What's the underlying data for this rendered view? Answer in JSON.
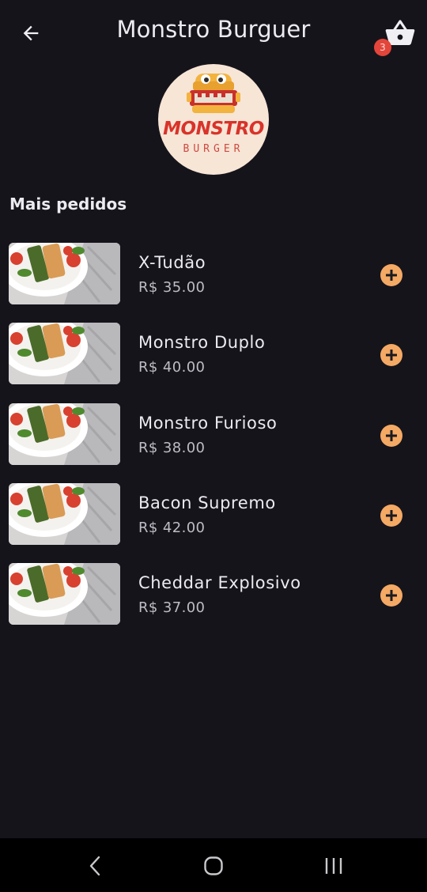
{
  "appbar": {
    "title": "Monstro Burguer",
    "back_icon": "arrow-left-icon",
    "cart_icon": "shopping-basket-icon",
    "cart_count": "3"
  },
  "logo": {
    "title": "MONSTRO",
    "subtitle": "BURGER"
  },
  "section": {
    "title": "Mais pedidos"
  },
  "products": [
    {
      "name": "X-Tudão",
      "price": "R$ 35.00"
    },
    {
      "name": "Monstro Duplo",
      "price": "R$ 40.00"
    },
    {
      "name": "Monstro Furioso",
      "price": "R$ 38.00"
    },
    {
      "name": "Bacon Supremo",
      "price": "R$ 42.00"
    },
    {
      "name": "Cheddar Explosivo",
      "price": "R$ 37.00"
    }
  ],
  "system_nav": {
    "back_icon": "chevron-left-icon",
    "home_icon": "home-circle-icon",
    "recents_icon": "recents-bars-icon"
  },
  "colors": {
    "background": "#16141b",
    "accent": "#f4a964",
    "badge": "#e3453b",
    "logo_red": "#d9332a"
  }
}
